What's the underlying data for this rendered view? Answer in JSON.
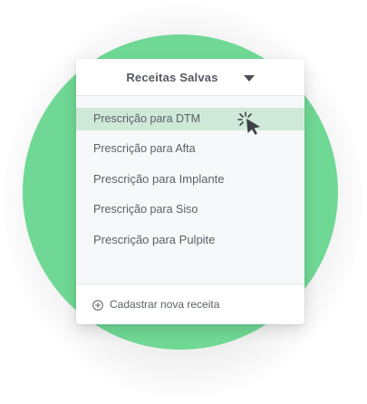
{
  "dropdown": {
    "title": "Receitas Salvas",
    "toggle_icon": "caret-down-icon"
  },
  "items": [
    {
      "label": "Prescrição para DTM",
      "selected": true
    },
    {
      "label": "Prescrição para Afta",
      "selected": false
    },
    {
      "label": "Prescrição para Implante",
      "selected": false
    },
    {
      "label": "Prescrição para Siso",
      "selected": false
    },
    {
      "label": "Prescrição para Pulpite",
      "selected": false
    }
  ],
  "cursor_icon": "click-pointer-icon",
  "footer": {
    "icon": "add-circle-icon",
    "label": "Cadastrar nova receita"
  },
  "colors": {
    "background_circle": "#6fd894",
    "selected_row": "#cfe9d8",
    "text": "#5c6066"
  }
}
